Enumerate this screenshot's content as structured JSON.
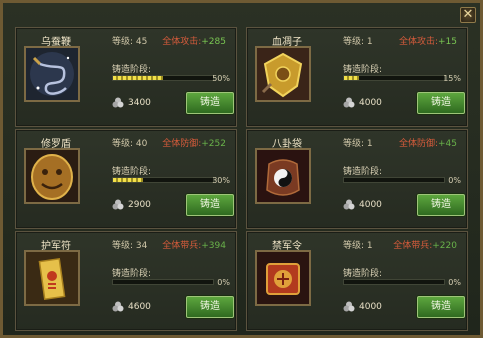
{
  "close_label": "✕",
  "forge_label": "铸造阶段:",
  "forge_button": "铸造",
  "cards": [
    {
      "name": "乌蚕鞭",
      "level": "等级: 45",
      "bonus_label": "全体攻击:",
      "bonus_value": "+285",
      "progress_pct": 50,
      "pct_text": "50%",
      "cost": "3400",
      "icon": "whip-icon"
    },
    {
      "name": "血凋子",
      "level": "等级: 1",
      "bonus_label": "全体攻击:",
      "bonus_value": "+15",
      "progress_pct": 15,
      "pct_text": "15%",
      "cost": "4000",
      "icon": "gold-shield-icon"
    },
    {
      "name": "修罗盾",
      "level": "等级: 40",
      "bonus_label": "全体防御:",
      "bonus_value": "+252",
      "progress_pct": 30,
      "pct_text": "30%",
      "cost": "2900",
      "icon": "beast-shield-icon"
    },
    {
      "name": "八卦袋",
      "level": "等级: 1",
      "bonus_label": "全体防御:",
      "bonus_value": "+45",
      "progress_pct": 0,
      "pct_text": "0%",
      "cost": "4000",
      "icon": "bagua-bag-icon"
    },
    {
      "name": "护军符",
      "level": "等级: 34",
      "bonus_label": "全体带兵:",
      "bonus_value": "+394",
      "progress_pct": 0,
      "pct_text": "0%",
      "cost": "4600",
      "icon": "talisman-icon"
    },
    {
      "name": "禁军令",
      "level": "等级: 1",
      "bonus_label": "全体带兵:",
      "bonus_value": "+220",
      "progress_pct": 0,
      "pct_text": "0%",
      "cost": "4000",
      "icon": "token-icon"
    }
  ]
}
